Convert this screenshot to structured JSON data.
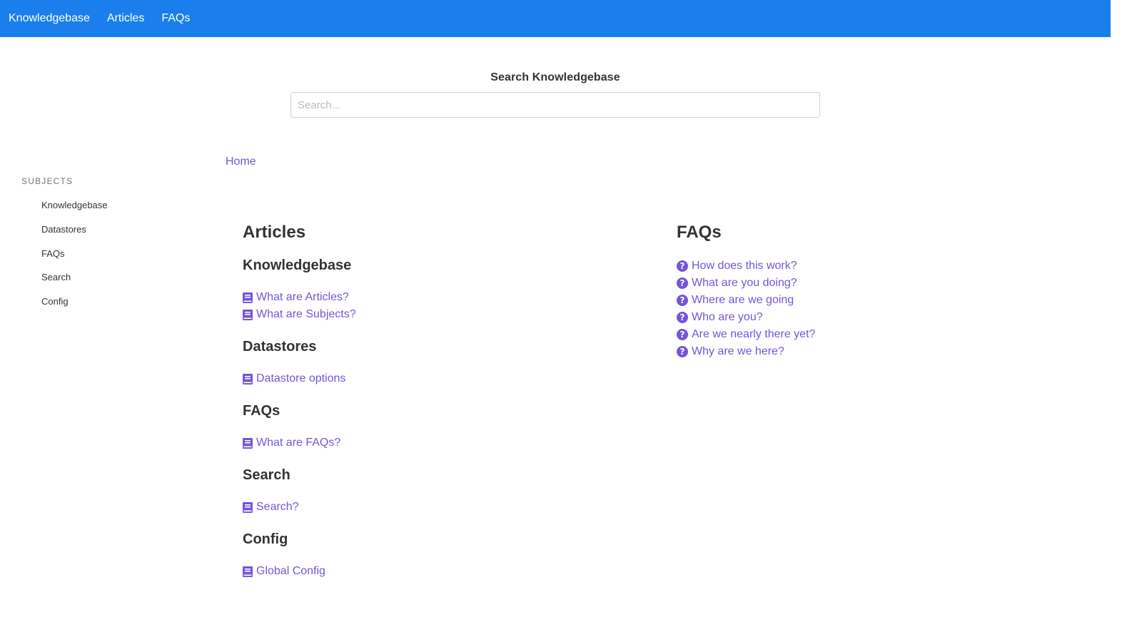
{
  "nav": {
    "brand": "Knowledgebase",
    "items": [
      "Articles",
      "FAQs"
    ]
  },
  "search": {
    "title": "Search Knowledgebase",
    "placeholder": "Search..."
  },
  "breadcrumb": {
    "home": "Home"
  },
  "sidebar": {
    "heading": "SUBJECTS",
    "items": [
      "Knowledgebase",
      "Datastores",
      "FAQs",
      "Search",
      "Config"
    ]
  },
  "articles": {
    "title": "Articles",
    "groups": [
      {
        "title": "Knowledgebase",
        "links": [
          "What are Articles?",
          "What are Subjects?"
        ]
      },
      {
        "title": "Datastores",
        "links": [
          "Datastore options"
        ]
      },
      {
        "title": "FAQs",
        "links": [
          "What are FAQs?"
        ]
      },
      {
        "title": "Search",
        "links": [
          "Search?"
        ]
      },
      {
        "title": "Config",
        "links": [
          "Global Config"
        ]
      }
    ]
  },
  "faqs": {
    "title": "FAQs",
    "links": [
      "How does this work?",
      "What are you doing?",
      "Where are we going",
      "Who are you?",
      "Are we nearly there yet?",
      "Why are we here?"
    ]
  },
  "colors": {
    "navbar": "#1a7fec",
    "link": "#7654d8"
  },
  "icons": {
    "article": "book-icon",
    "faq": "question-circle-icon"
  }
}
